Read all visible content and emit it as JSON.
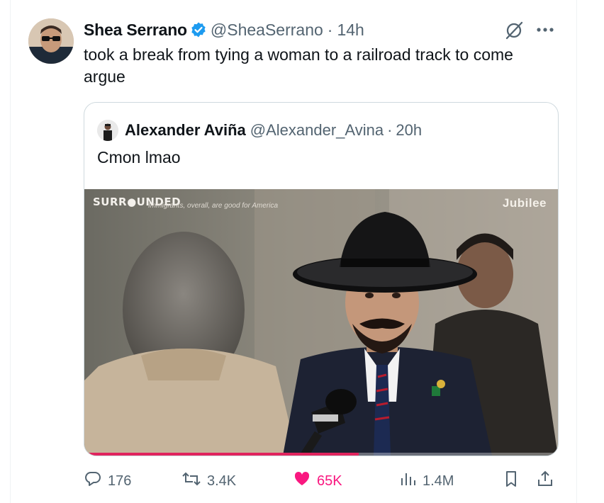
{
  "tweet": {
    "author_name": "Shea Serrano",
    "handle": "@SheaSerrano",
    "separator": "·",
    "time": "14h",
    "text": "took a break from tying a woman to a railroad track to come argue"
  },
  "quoted": {
    "author_name": "Alexander Aviña",
    "handle": "@Alexander_Avina",
    "separator": "·",
    "time": "20h",
    "text": "Cmon lmao",
    "video": {
      "watermark_left": "SURR●UNDED",
      "caption_overlay": "Immigrants, overall, are good for America",
      "watermark_right": "Jubilee",
      "progress_fraction": 0.58
    }
  },
  "actions": {
    "replies": "176",
    "reposts": "3.4K",
    "likes": "65K",
    "views": "1.4M"
  },
  "colors": {
    "verified": "#1d9bf0",
    "like": "#f91880",
    "muted": "#536471",
    "border": "#cfd9de"
  },
  "icons": [
    "verified-badge-icon",
    "grok-icon",
    "more-icon",
    "reply-icon",
    "repost-icon",
    "like-icon",
    "views-icon",
    "bookmark-icon",
    "share-icon"
  ]
}
